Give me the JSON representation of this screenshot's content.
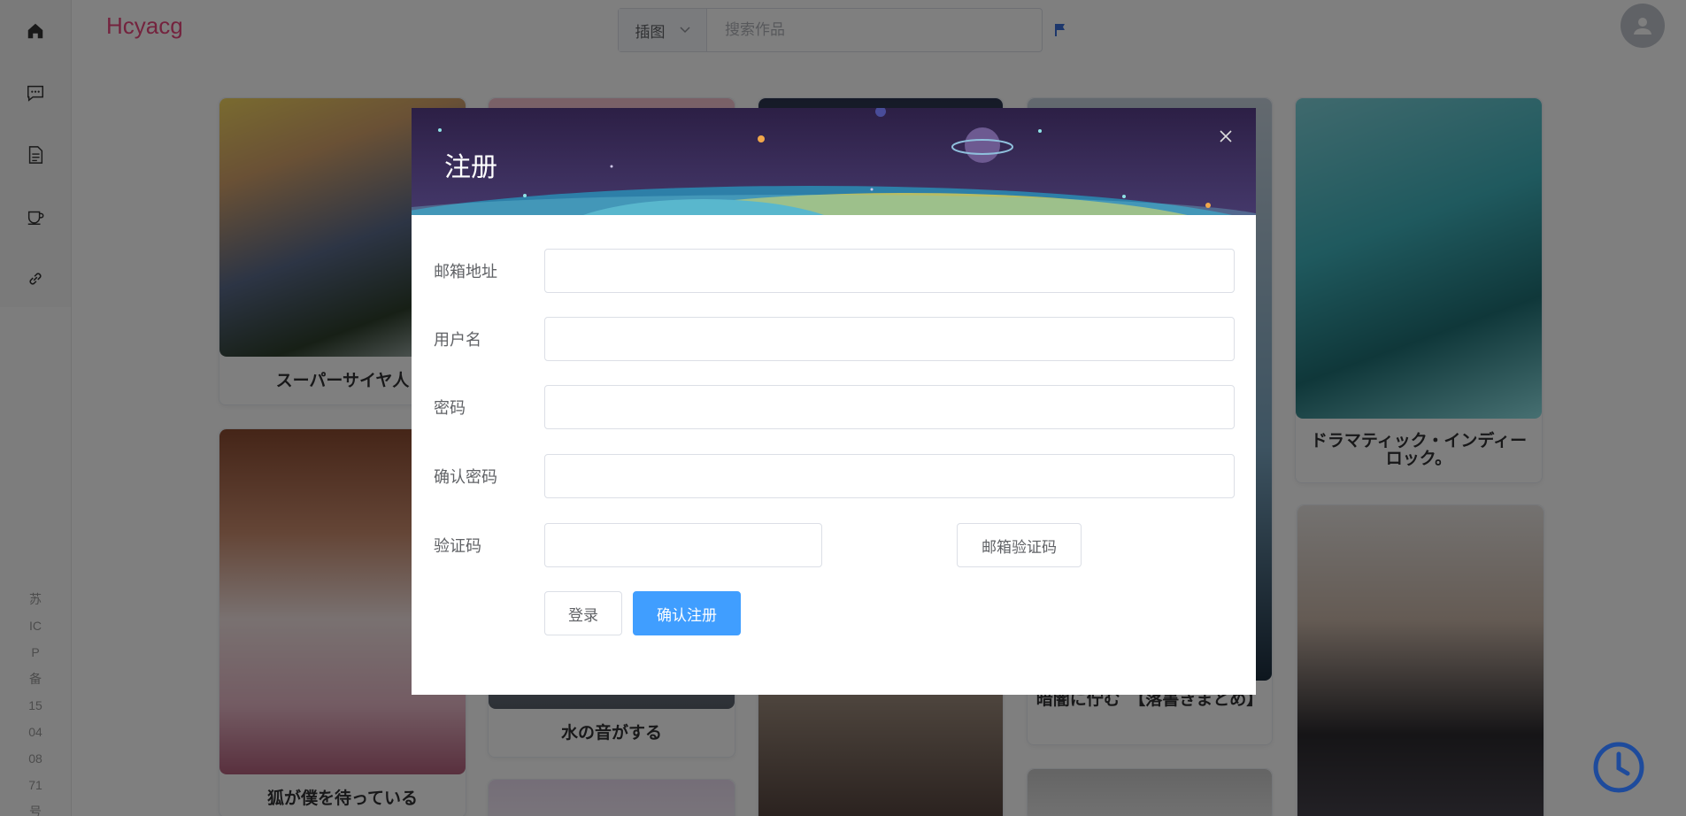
{
  "app": {
    "logo": "Hcyacg"
  },
  "sidebar": {
    "items": [
      {
        "icon": "home-icon"
      },
      {
        "icon": "chat-icon"
      },
      {
        "icon": "document-icon"
      },
      {
        "icon": "coffee-icon"
      },
      {
        "icon": "link-icon"
      }
    ],
    "icp": [
      "苏",
      "IC",
      "P",
      "备",
      "15",
      "04",
      "08",
      "71",
      "号"
    ]
  },
  "search": {
    "select_label": "插图",
    "placeholder": "搜索作品"
  },
  "cards": [
    {
      "title": "スーパーサイヤ人"
    },
    {
      "title": "ドラマティック・インディーロック。"
    },
    {
      "title": "狐が僕を待っている"
    },
    {
      "title": "水の音がする"
    },
    {
      "title": "暗闇に佇む　【落書きまとめ】"
    }
  ],
  "dialog": {
    "title": "注册",
    "fields": {
      "email_label": "邮箱地址",
      "username_label": "用户名",
      "password_label": "密码",
      "confirm_label": "确认密码",
      "code_label": "验证码"
    },
    "buttons": {
      "send_code": "邮箱验证码",
      "login": "登录",
      "submit": "确认注册"
    }
  },
  "colors": {
    "brand": "#e8467c",
    "primary": "#409eff",
    "clock": "#1e4b9c"
  }
}
